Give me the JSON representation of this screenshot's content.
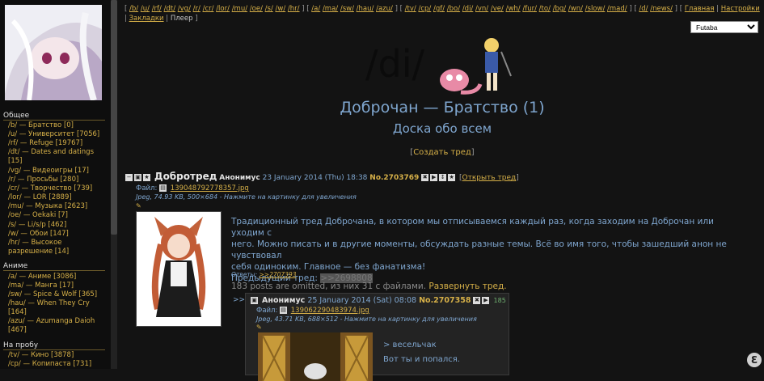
{
  "sidebar": {
    "sections": [
      {
        "title": "Общее",
        "items": [
          "/b/ — Братство [0]",
          "/u/ — Университет [7056]",
          "/rf/ — Refuge [19767]",
          "/dt/ — Dates and datings",
          "[15]",
          "/vg/ — Видеоигры [17]",
          "/r/ — Просьбы [280]",
          "/cr/ — Творчество [739]",
          "/lor/ — LOR [2889]",
          "/mu/ — Музыка [2623]",
          "/oe/ — Oekaki [7]",
          "/s/ — Li/s/p [462]",
          "/w/ — Обои [147]",
          "/hr/ — Высокое",
          "разрешение [14]"
        ]
      },
      {
        "title": "Аниме",
        "items": [
          "/a/ — Аниме [3086]",
          "/ma/ — Манга [17]",
          "/sw/ — Spice & Wolf [365]",
          "/hau/ — When They Cry",
          "[164]",
          "/azu/ — Azumanga Daioh",
          "[467]"
        ]
      },
      {
        "title": "На пробу",
        "items": [
          "/tv/ — Кино [3878]",
          "/cp/ — Копипаста [731]"
        ]
      }
    ]
  },
  "topnav": {
    "group1": [
      "b",
      "u",
      "rf",
      "dt",
      "vg",
      "r",
      "cr",
      "lor",
      "mu",
      "oe",
      "s",
      "w",
      "hr"
    ],
    "group2": [
      "a",
      "ma",
      "sw",
      "hau",
      "azu"
    ],
    "group3": [
      "tv",
      "cp",
      "gf",
      "bo",
      "di",
      "vn",
      "ve",
      "wh",
      "fur",
      "to",
      "bg",
      "wn",
      "slow",
      "mad"
    ],
    "group4": [
      "d",
      "news"
    ],
    "links": [
      "Главная",
      "Настройки",
      "Закладки",
      "Плеер"
    ]
  },
  "style_select": {
    "selected": "Futaba"
  },
  "header": {
    "board": "/di/",
    "title": "Доброчан — Братство (1)",
    "subtitle": "Доска обо всем",
    "create_thread": "Создать тред"
  },
  "op": {
    "subject": "Добротред",
    "name": "Анонимус",
    "date": "23 January 2014 (Thu) 18:38",
    "number": "No.2703769",
    "open_link": "Открыть тред",
    "file_label": "Файл:",
    "file_name": "139048792778357.jpg",
    "file_meta": "Jpeg, 74.93 KB, 500×684 - Нажмите на картинку для увеличения",
    "text_line1": "Традиционный тред Доброчана, в котором мы отписываемся каждый раз, когда заходим на Доброчан или уходим с",
    "text_line2": "него. Можно писать и в другие моменты, обсуждать разные темы. Всё во имя того, чтобы зашедший анон не чувствовал",
    "text_line3": "себя одиноким. Главное — без фанатизма!",
    "text_line4": "Предыдущий тред:",
    "prev_thread": ">>2698808",
    "replies_label": "Ответы:",
    "replies_link": ">>2707393",
    "omitted_text": "183 posts are omitted, из них 31 с файлами.",
    "expand_link": "Развернуть тред."
  },
  "reply": {
    "arrow": ">>",
    "name": "Анонимус",
    "date": "25 January 2014 (Sat) 08:08",
    "number": "No.2707358",
    "counter": "185",
    "file_label": "Файл:",
    "file_name": "139062290483974.jpg",
    "file_meta": "Jpeg, 43.71 KB, 688×512 - Нажмите на картинку для увеличения",
    "quote": "> весельчак",
    "text": "Вот ты и попался."
  }
}
